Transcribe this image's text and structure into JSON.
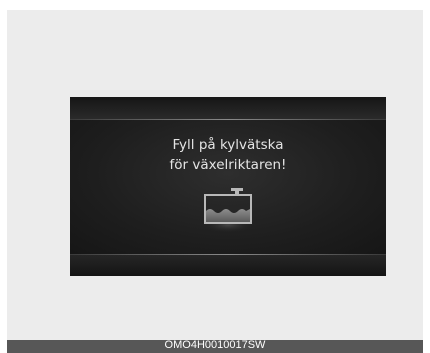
{
  "display": {
    "message_line1": "Fyll på kylvätska",
    "message_line2": "för växelriktaren!",
    "icon": "coolant-reservoir-icon"
  },
  "caption": {
    "image_code": "OMO4H0010017SW"
  }
}
